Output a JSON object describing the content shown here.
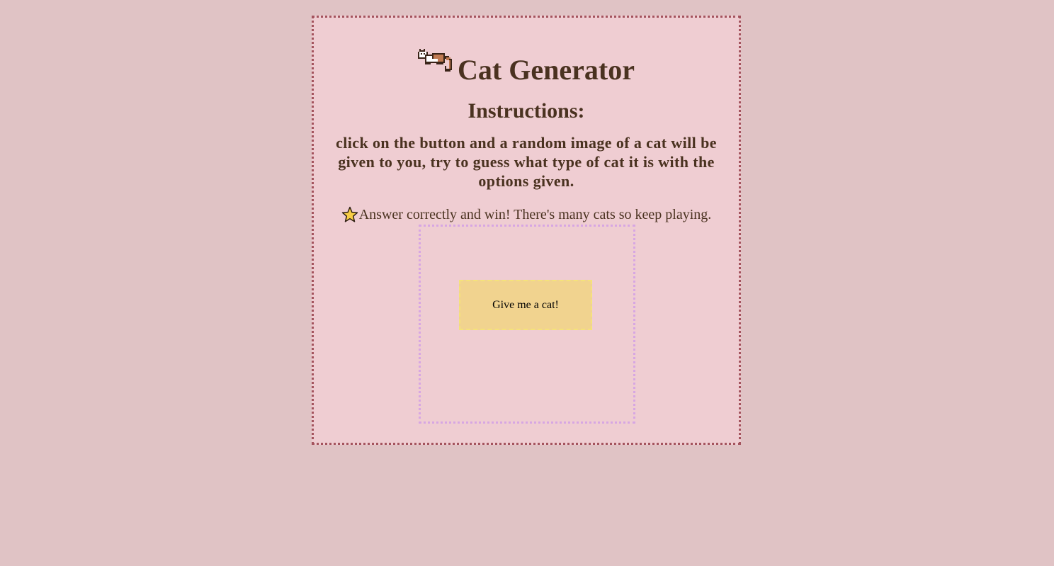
{
  "header": {
    "title": "Cat Generator",
    "logo_icon": "pixel-cat-icon"
  },
  "instructions": {
    "heading": "Instructions:",
    "body": "click on the button and a random image of a cat will be given to you, try to guess what type of cat it is with the options given."
  },
  "tip": {
    "icon": "star-icon",
    "text": "Answer correctly and win! There's many cats so keep playing."
  },
  "game": {
    "button_label": "Give me a cat!"
  },
  "colors": {
    "page_background": "#e0c3c5",
    "card_background": "#efcdd2",
    "card_border": "#a4545e",
    "text": "#4a3220",
    "game_box_border": "#d7a6e3",
    "button_background": "#f1d38f",
    "button_border": "#f5e27a"
  }
}
